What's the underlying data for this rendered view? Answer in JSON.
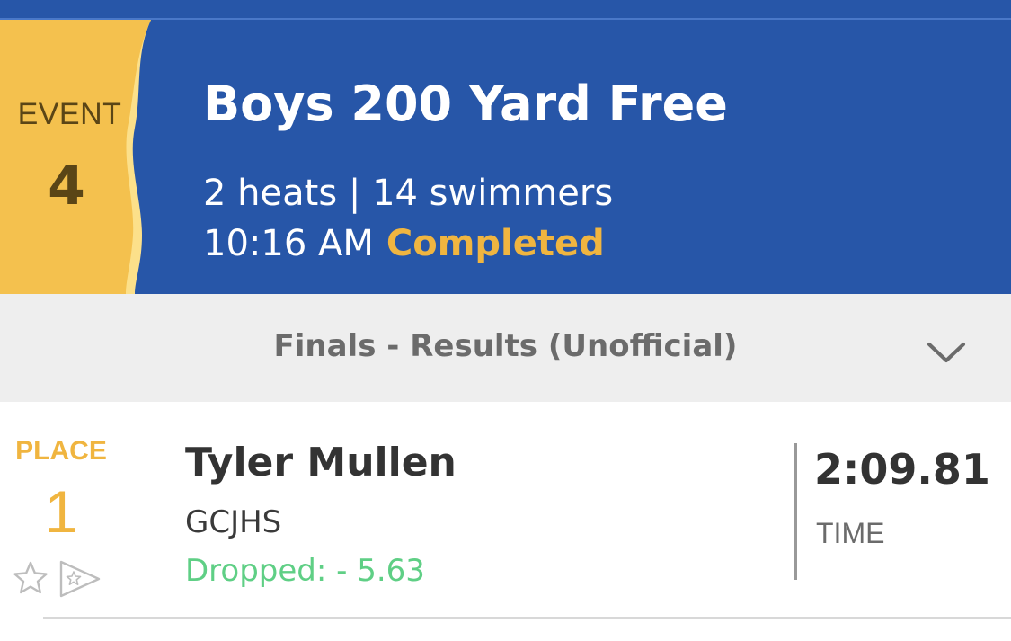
{
  "event": {
    "label": "EVENT",
    "number": "4",
    "title": "Boys 200 Yard Free",
    "meta": "2 heats | 14 swimmers",
    "time": "10:16 AM",
    "status": "Completed"
  },
  "results": {
    "title": "Finals - Results (Unofficial)"
  },
  "result_row": {
    "place_label": "PLACE",
    "place": "1",
    "name": "Tyler Mullen",
    "team": "GCJHS",
    "drop": "Dropped: - 5.63",
    "time": "2:09.81",
    "time_label": "TIME"
  },
  "colors": {
    "header_blue": "#2756a8",
    "badge_gold": "#f4c14e",
    "accent_orange": "#f0b540",
    "drop_green": "#5fcf85"
  },
  "icons": {
    "chevron": "chevron-down-icon",
    "favorite": "star-outline-icon",
    "share": "share-star-icon"
  }
}
